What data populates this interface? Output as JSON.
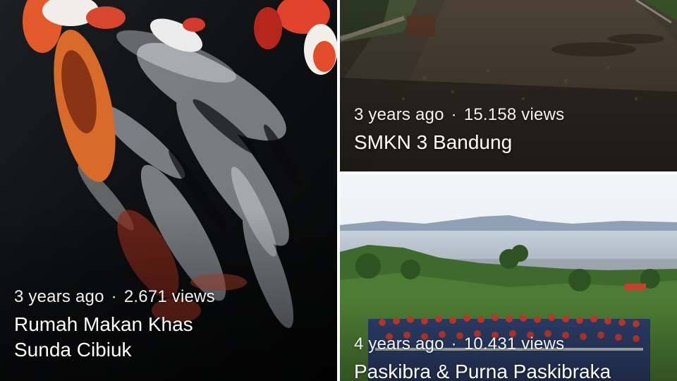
{
  "gallery": {
    "items": [
      {
        "time_ago": "3 years ago",
        "separator": "·",
        "views": "2.671 views",
        "title_line1": "Rumah Makan Khas",
        "title_line2": "Sunda Cibiuk"
      },
      {
        "time_ago": "3 years ago",
        "separator": "·",
        "views": "15.158 views",
        "title_line1": "SMKN 3 Bandung"
      },
      {
        "time_ago": "4 years ago",
        "separator": "·",
        "views": "10.431 views",
        "title_line1": "Paskibra & Purna Paskibraka"
      }
    ]
  }
}
